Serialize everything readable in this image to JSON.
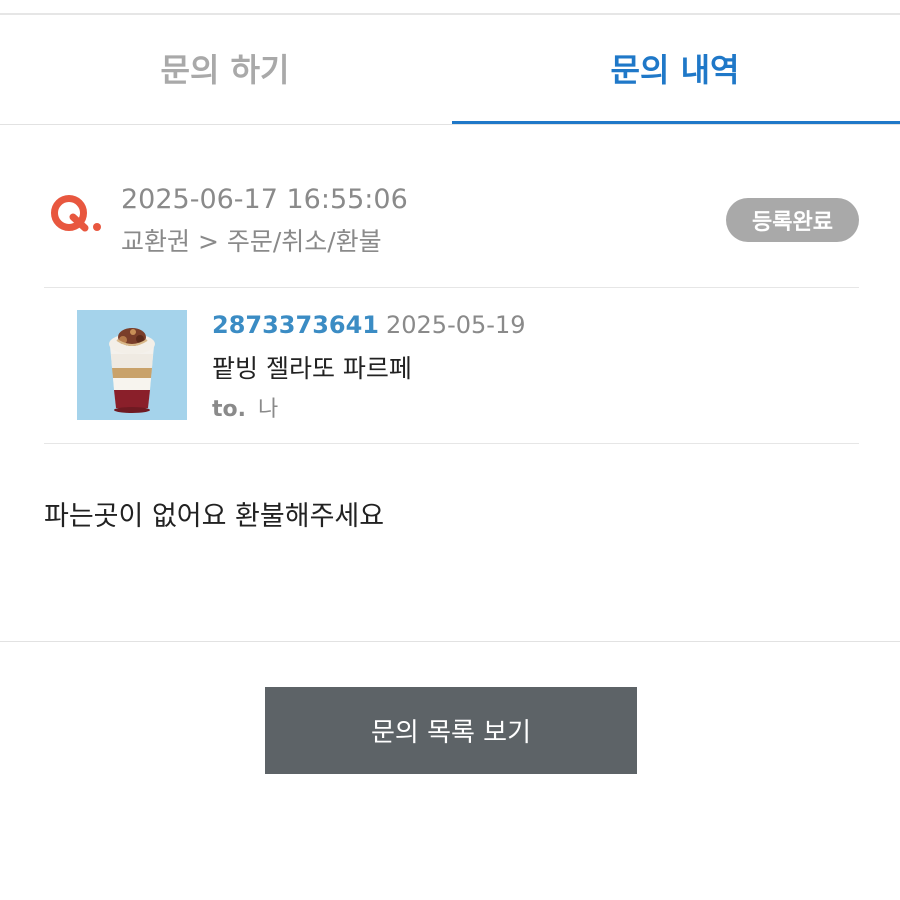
{
  "tabs": [
    {
      "label": "문의 하기",
      "active": false
    },
    {
      "label": "문의 내역",
      "active": true
    }
  ],
  "inquiry": {
    "datetime": "2025-06-17 16:55:06",
    "category": "교환권 > 주문/취소/환불",
    "status": "등록완료",
    "body": "파는곳이 없어요 환불해주세요"
  },
  "product": {
    "order_number": "2873373641",
    "date": "2025-05-19",
    "name": "팥빙 젤라또 파르페",
    "to_label": "to.",
    "to_value": "나"
  },
  "actions": {
    "list_button": "문의 목록 보기"
  },
  "colors": {
    "accent": "#1f78c8",
    "q_mark": "#e8573f",
    "badge": "#a9a9a9",
    "button": "#5d6367",
    "order_number": "#3b8cc4"
  },
  "icons": {
    "q_mark": "q-mark-icon"
  }
}
